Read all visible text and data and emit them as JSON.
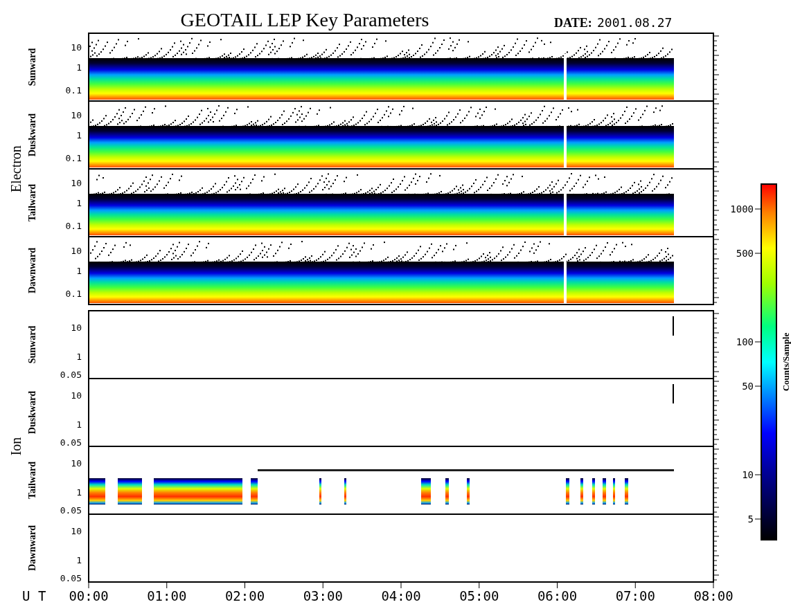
{
  "title": "GEOTAIL LEP Key Parameters",
  "date_label": "DATE:",
  "date": "2001.08.27",
  "groups": [
    {
      "name": "Electron",
      "panels": [
        {
          "name": "Sunward",
          "kind": "full",
          "yticks": [
            "10",
            "1",
            "0.1"
          ]
        },
        {
          "name": "Duskward",
          "kind": "full",
          "yticks": [
            "10",
            "1",
            "0.1"
          ]
        },
        {
          "name": "Tailward",
          "kind": "full",
          "yticks": [
            "10",
            "1",
            "0.1"
          ]
        },
        {
          "name": "Dawnward",
          "kind": "full",
          "yticks": [
            "10",
            "1",
            "0.1"
          ]
        }
      ]
    },
    {
      "name": "Ion",
      "panels": [
        {
          "name": "Sunward",
          "kind": "empty",
          "yticks": [
            "10",
            "1",
            "0.05"
          ]
        },
        {
          "name": "Duskward",
          "kind": "empty",
          "yticks": [
            "10",
            "1",
            "0.05"
          ]
        },
        {
          "name": "Tailward",
          "kind": "patchy",
          "yticks": [
            "10",
            "1",
            "0.05"
          ]
        },
        {
          "name": "Dawnward",
          "kind": "blank",
          "yticks": [
            "10",
            "1",
            "0.05"
          ]
        }
      ]
    }
  ],
  "x_axis": {
    "label": "U T",
    "ticks": [
      "00:00",
      "01:00",
      "02:00",
      "03:00",
      "04:00",
      "05:00",
      "06:00",
      "07:00",
      "08:00"
    ]
  },
  "colorbar": {
    "label": "Counts/Sample",
    "ticks": [
      "1000",
      "500",
      "100",
      "50",
      "10",
      "5"
    ]
  }
}
